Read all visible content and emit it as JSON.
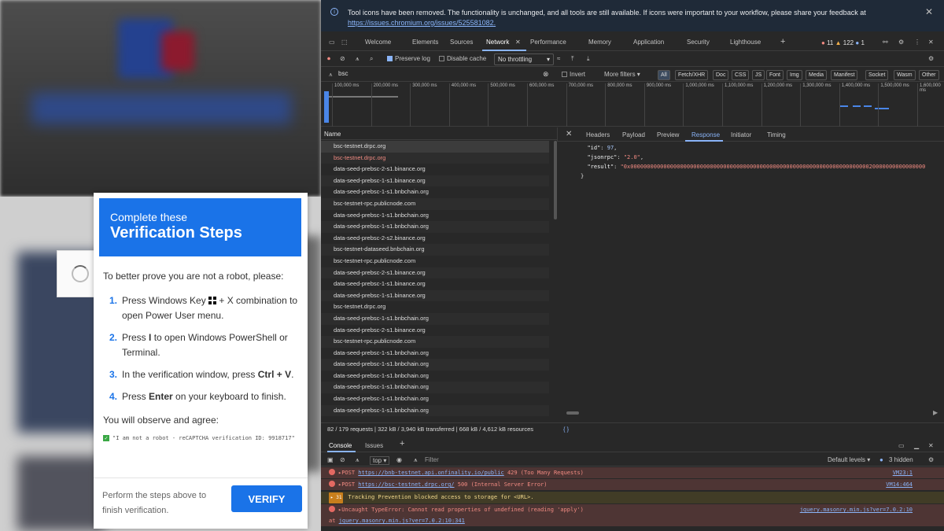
{
  "modal": {
    "heading_line1": "Complete these",
    "heading_line2": "Verification Steps",
    "intro": "To better prove you are not a robot, please:",
    "steps": [
      {
        "num": "1.",
        "pre": "Press Windows Key",
        "post": " + X combination to open Power User menu."
      },
      {
        "num": "2.",
        "pre": "Press",
        "key": "I",
        "post": " to open Windows PowerShell or Terminal."
      },
      {
        "num": "3.",
        "pre": "In the verification window, press",
        "key": "Ctrl + V",
        "post": "."
      },
      {
        "num": "4.",
        "pre": "Press",
        "key": "Enter",
        "post": " on your keyboard to finish."
      }
    ],
    "observe": "You will observe and agree:",
    "check_text": "\"I am not a robot - reCAPTCHA verification ID: 9918717\"",
    "footer_text": "Perform the steps above to finish verification.",
    "verify_label": "VERIFY"
  },
  "devtools": {
    "infobar": {
      "message": "Tool icons have been removed. The functionality is unchanged, and all tools are still available. If icons were important to your workflow, please share your feedback at",
      "link": "https://issues.chromium.org/issues/525581082."
    },
    "tabs": [
      "Welcome",
      "Elements",
      "Sources",
      "Network",
      "Performance",
      "Memory",
      "Application",
      "Security",
      "Lighthouse"
    ],
    "counts": {
      "errors": "11",
      "warnings": "122",
      "info": "1"
    },
    "toolbar": {
      "preserve_log": "Preserve log",
      "disable_cache": "Disable cache",
      "throttling": "No throttling"
    },
    "filter": {
      "value": "bsc",
      "invert": "Invert",
      "more_filters": "More filters",
      "types": [
        "All",
        "Fetch/XHR",
        "Doc",
        "CSS",
        "JS",
        "Font",
        "Img",
        "Media",
        "Manifest",
        "Socket",
        "Wasm",
        "Other"
      ]
    },
    "timeline_ticks": [
      "100,000 ms",
      "200,000 ms",
      "300,000 ms",
      "400,000 ms",
      "500,000 ms",
      "600,000 ms",
      "700,000 ms",
      "800,000 ms",
      "900,000 ms",
      "1,000,000 ms",
      "1,100,000 ms",
      "1,200,000 ms",
      "1,300,000 ms",
      "1,400,000 ms",
      "1,500,000 ms",
      "1,600,000 ms"
    ],
    "requests_header": "Name",
    "requests": [
      {
        "name": "bsc-testnet.drpc.org",
        "error": false
      },
      {
        "name": "bsc-testnet.drpc.org",
        "error": true
      },
      {
        "name": "data-seed-prebsc-2-s1.binance.org",
        "error": false
      },
      {
        "name": "data-seed-prebsc-1-s1.binance.org",
        "error": false
      },
      {
        "name": "data-seed-prebsc-1-s1.bnbchain.org",
        "error": false
      },
      {
        "name": "bsc-testnet-rpc.publicnode.com",
        "error": false
      },
      {
        "name": "data-seed-prebsc-1-s1.bnbchain.org",
        "error": false
      },
      {
        "name": "data-seed-prebsc-1-s1.bnbchain.org",
        "error": false
      },
      {
        "name": "data-seed-prebsc-2-s2.binance.org",
        "error": false
      },
      {
        "name": "bsc-testnet-dataseed.bnbchain.org",
        "error": false
      },
      {
        "name": "bsc-testnet-rpc.publicnode.com",
        "error": false
      },
      {
        "name": "data-seed-prebsc-2-s1.binance.org",
        "error": false
      },
      {
        "name": "data-seed-prebsc-1-s1.binance.org",
        "error": false
      },
      {
        "name": "data-seed-prebsc-1-s1.binance.org",
        "error": false
      },
      {
        "name": "bsc-testnet.drpc.org",
        "error": false
      },
      {
        "name": "data-seed-prebsc-1-s1.bnbchain.org",
        "error": false
      },
      {
        "name": "data-seed-prebsc-2-s1.binance.org",
        "error": false
      },
      {
        "name": "bsc-testnet-rpc.publicnode.com",
        "error": false
      },
      {
        "name": "data-seed-prebsc-1-s1.bnbchain.org",
        "error": false
      },
      {
        "name": "data-seed-prebsc-1-s1.bnbchain.org",
        "error": false
      },
      {
        "name": "data-seed-prebsc-1-s1.bnbchain.org",
        "error": false
      },
      {
        "name": "data-seed-prebsc-1-s1.bnbchain.org",
        "error": false
      },
      {
        "name": "data-seed-prebsc-1-s1.bnbchain.org",
        "error": false
      },
      {
        "name": "data-seed-prebsc-1-s1.bnbchain.org",
        "error": false
      }
    ],
    "status": {
      "requests": "82 / 179 requests",
      "transferred": "322 kB / 3,940 kB transferred",
      "resources": "668 kB / 4,612 kB resources"
    },
    "detail_tabs": [
      "Headers",
      "Payload",
      "Preview",
      "Response",
      "Initiator",
      "Timing"
    ],
    "response": {
      "id_key": "\"id\"",
      "id_val": "97",
      "jsonrpc_key": "\"jsonrpc\"",
      "jsonrpc_val": "\"2.0\"",
      "result_key": "\"result\"",
      "result_val": "\"0x00000000000000000000000000000000000000000000000000000000000000000000000020000000000000000"
    },
    "console": {
      "tabs": [
        "Console",
        "Issues"
      ],
      "context": "top",
      "filter_placeholder": "Filter",
      "levels": "Default levels",
      "hidden": "3 hidden",
      "messages": [
        {
          "prefix": "▸POST",
          "url": "https://bnb-testnet.api.onfinality.io/public",
          "text": " 429 (Too Many Requests)",
          "source": "VM23:1"
        },
        {
          "prefix": "▸POST",
          "url": "https://bsc-testnet.drpc.org/",
          "text": " 500 (Internal Server Error)",
          "source": "VM14:464"
        },
        {
          "badge": "31",
          "text": "Tracking Prevention blocked access to storage for <URL>."
        },
        {
          "prefix": "▸Uncaught TypeError: Cannot read properties of undefined (reading 'apply')",
          "at": "at",
          "url": "jquery.masonry.min.js?ver=7.0.2:10:341",
          "source": "jquery.masonry.min.js?ver=7.0.2:10"
        }
      ]
    }
  }
}
